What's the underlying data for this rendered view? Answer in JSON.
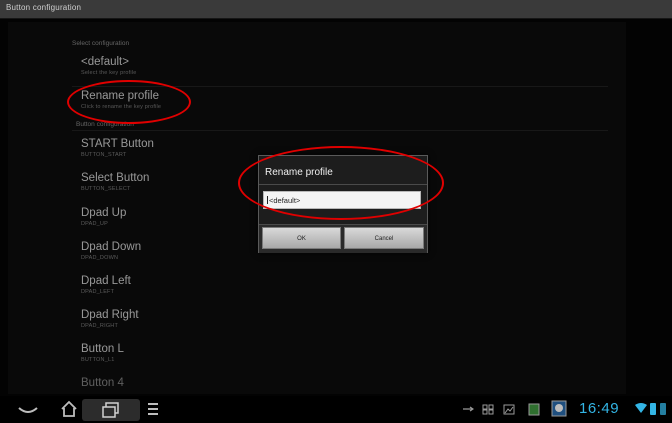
{
  "window": {
    "title": "Button configuration"
  },
  "sections": {
    "select_configuration": "Select configuration",
    "button_configuration": "Button configuration"
  },
  "profile_items": [
    {
      "title": "<default>",
      "subtitle": "Select the key profile"
    },
    {
      "title": "Rename profile",
      "subtitle": "Click to rename the key profile"
    }
  ],
  "button_items": [
    {
      "title": "START Button",
      "subtitle": "BUTTON_START"
    },
    {
      "title": "Select Button",
      "subtitle": "BUTTON_SELECT"
    },
    {
      "title": "Dpad Up",
      "subtitle": "DPAD_UP"
    },
    {
      "title": "Dpad Down",
      "subtitle": "DPAD_DOWN"
    },
    {
      "title": "Dpad Left",
      "subtitle": "DPAD_LEFT"
    },
    {
      "title": "Dpad Right",
      "subtitle": "DPAD_RIGHT"
    },
    {
      "title": "Button L",
      "subtitle": "BUTTON_L1"
    },
    {
      "title": "Button 4",
      "subtitle": ""
    }
  ],
  "dialog": {
    "title": "Rename profile",
    "input_value": "<default>",
    "ok_label": "OK",
    "cancel_label": "Cancel"
  },
  "statusbar": {
    "clock": "16:49"
  },
  "icons": {
    "back": "back-icon",
    "home": "home-icon",
    "recent": "recent-apps-icon",
    "menu": "menu-icon"
  },
  "colors": {
    "accent": "#33b5e5",
    "annotation": "#e00000"
  }
}
